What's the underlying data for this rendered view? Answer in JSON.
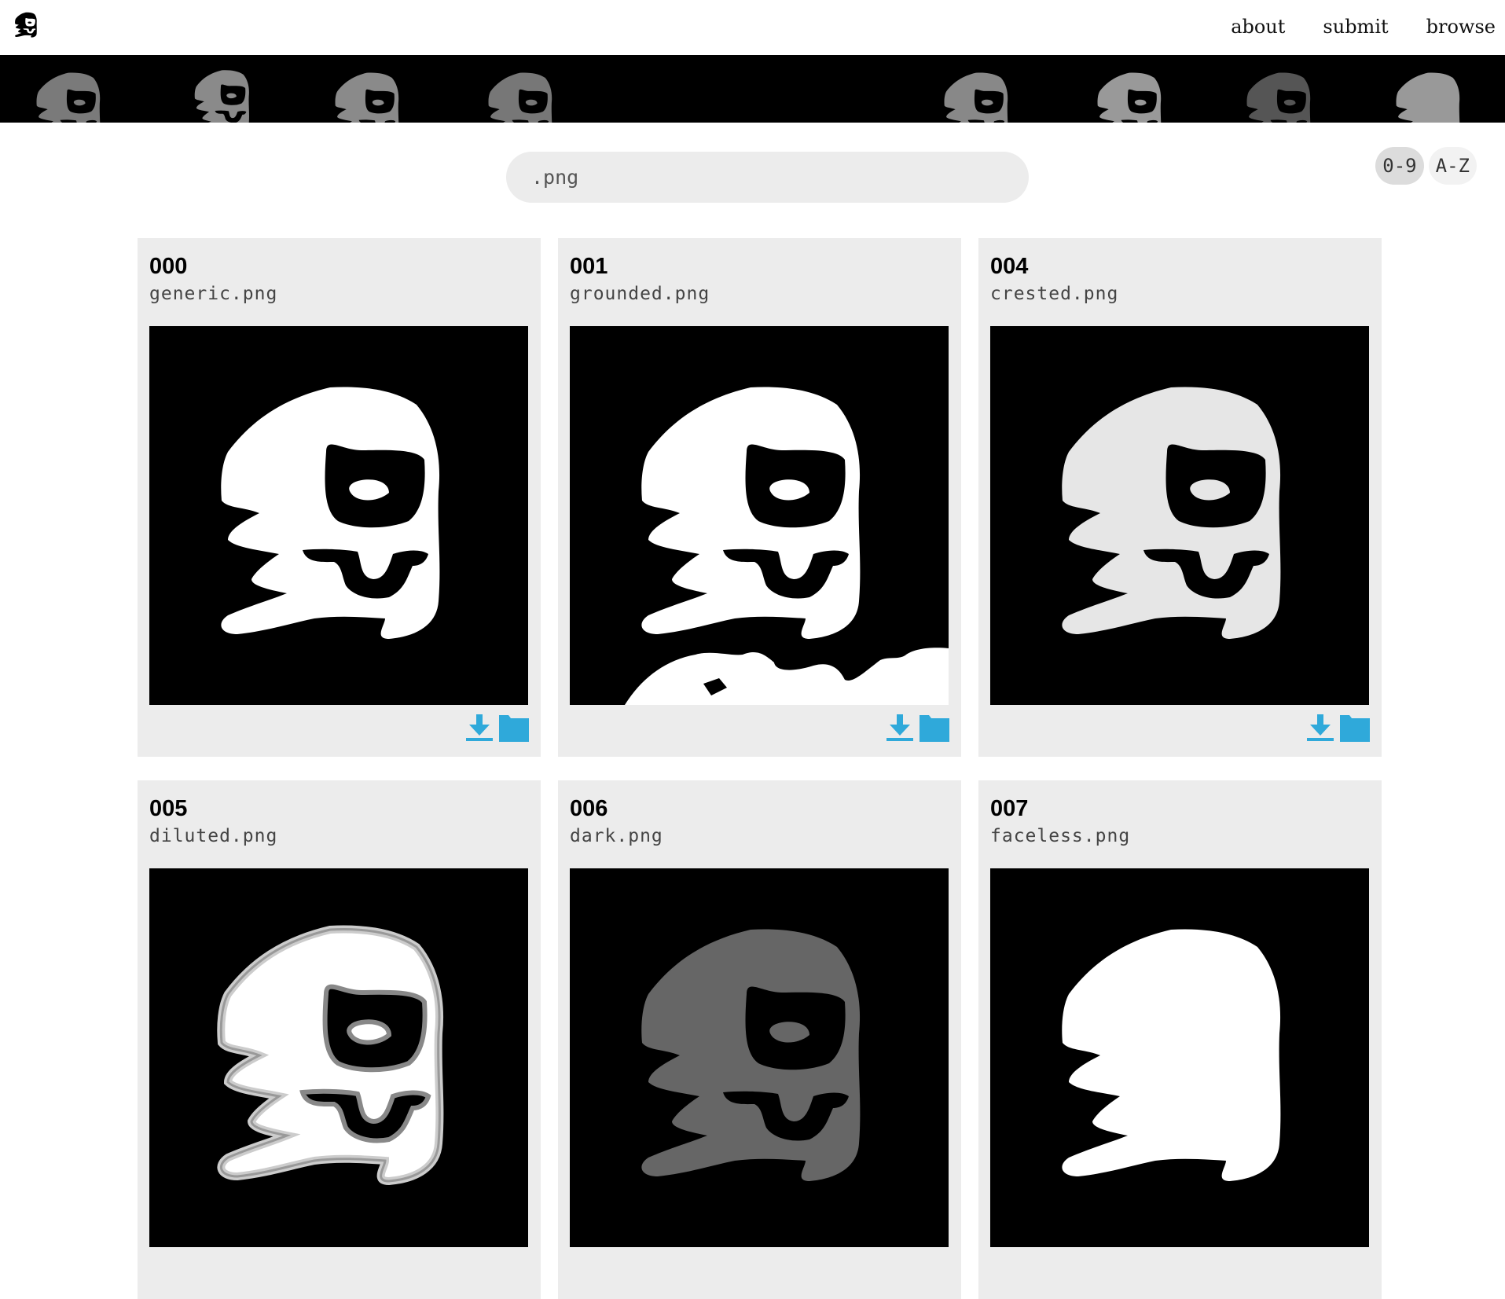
{
  "nav": {
    "about": "about",
    "submit": "submit",
    "browse": "browse"
  },
  "search": {
    "value": ".png"
  },
  "sort": {
    "numeric": "0-9",
    "alpha": "A-Z"
  },
  "cards": [
    {
      "num": "000",
      "file": "generic.png"
    },
    {
      "num": "001",
      "file": "grounded.png"
    },
    {
      "num": "004",
      "file": "crested.png"
    },
    {
      "num": "005",
      "file": "diluted.png"
    },
    {
      "num": "006",
      "file": "dark.png"
    },
    {
      "num": "007",
      "file": "faceless.png"
    }
  ],
  "icons": {
    "download": "download-icon",
    "folder": "folder-icon"
  },
  "colors": {
    "accent": "#2fa9da",
    "card_bg": "#ececec",
    "banner_bg": "#000000"
  }
}
